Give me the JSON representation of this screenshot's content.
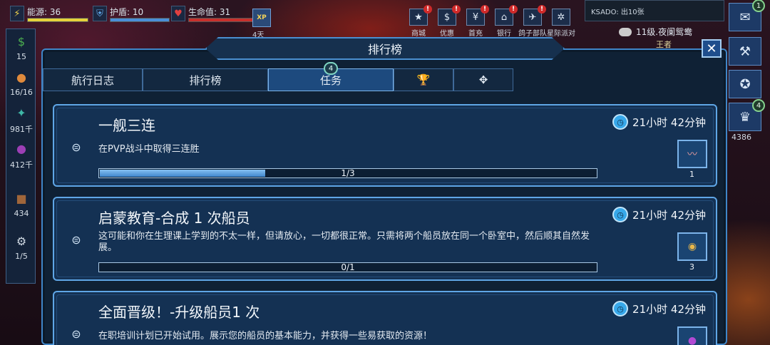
{
  "hud": {
    "energy_label": "能源: 36",
    "shield_label": "护盾: 10",
    "hp_label": "生命值: 31",
    "xp_label": "XP",
    "xp_sub": "4天"
  },
  "top_icons": [
    {
      "label": "商城",
      "icon": "star-icon",
      "glyph": "★",
      "alert": "!"
    },
    {
      "label": "优惠",
      "icon": "dollar-icon",
      "glyph": "$",
      "alert": "!"
    },
    {
      "label": "首充",
      "icon": "yen-icon",
      "glyph": "¥",
      "alert": "!"
    },
    {
      "label": "银行",
      "icon": "bank-icon",
      "glyph": "⌂",
      "alert": "!"
    },
    {
      "label": "鸽子部队",
      "icon": "plane-icon",
      "glyph": "✈",
      "alert": "!"
    },
    {
      "label": "星际派对",
      "icon": "gear-icon",
      "glyph": "✲",
      "alert": ""
    }
  ],
  "ksado": "KSADO: 出10张",
  "level_text": "11级.夜阑鸳鸯",
  "king_text": "王者",
  "sidebar": [
    {
      "label": "15",
      "icon": "cash-icon",
      "glyph": "$",
      "color": "#4caf50"
    },
    {
      "label": "16/16",
      "icon": "crew-icon",
      "glyph": "●",
      "color": "#e08a3c"
    },
    {
      "label": "981千",
      "icon": "crystal-icon",
      "glyph": "✦",
      "color": "#3fb7a6"
    },
    {
      "label": "412千",
      "icon": "gas-icon",
      "glyph": "●",
      "color": "#9c3fb5"
    },
    {
      "label": "434",
      "icon": "crate-icon",
      "glyph": "■",
      "color": "#a0663a"
    },
    {
      "label": "1/5",
      "icon": "ship-icon",
      "glyph": "⚙",
      "color": "#cfd8e2"
    }
  ],
  "right_sidebar": [
    {
      "icon": "chat-icon",
      "glyph": "✉",
      "badge": "1"
    },
    {
      "icon": "hammer-icon",
      "glyph": "⚒",
      "badge": ""
    },
    {
      "icon": "fleet-icon",
      "glyph": "✪",
      "badge": ""
    },
    {
      "icon": "trophy-icon",
      "glyph": "♛",
      "badge": "4"
    }
  ],
  "right_number": "4386",
  "panel": {
    "title": "排行榜",
    "close": "✕"
  },
  "tabs": [
    {
      "label": "航行日志",
      "active": false,
      "badge": ""
    },
    {
      "label": "排行榜",
      "active": false,
      "badge": ""
    },
    {
      "label": "任务",
      "active": true,
      "badge": "4"
    },
    {
      "label": "🏆",
      "active": false,
      "badge": ""
    },
    {
      "label": "✥",
      "active": false,
      "badge": ""
    }
  ],
  "quests": [
    {
      "title": "一舰三连",
      "desc": "在PVP战斗中取得三连胜",
      "time": "21小时 42分钟",
      "progress_text": "1/3",
      "progress": 0.333,
      "reward_count": "1",
      "reward_icon": "worm-icon"
    },
    {
      "title": "启蒙教育-合成 1 次船员",
      "desc": "这可能和你在生理课上学到的不太一样，但请放心，一切都很正常。只需将两个船员放在同一个卧室中，然后顺其自然发展。",
      "time": "21小时 42分钟",
      "progress_text": "0/1",
      "progress": 0,
      "reward_count": "3",
      "reward_icon": "medal-icon"
    },
    {
      "title": "全面晋级！-升级船员1 次",
      "desc": "在职培训计划已开始试用。展示您的船员的基本能力，并获得一些易获取的资源！",
      "time": "21小时 42分钟",
      "progress_text": "",
      "progress": 0,
      "reward_count": "",
      "reward_icon": "orb-icon"
    }
  ]
}
